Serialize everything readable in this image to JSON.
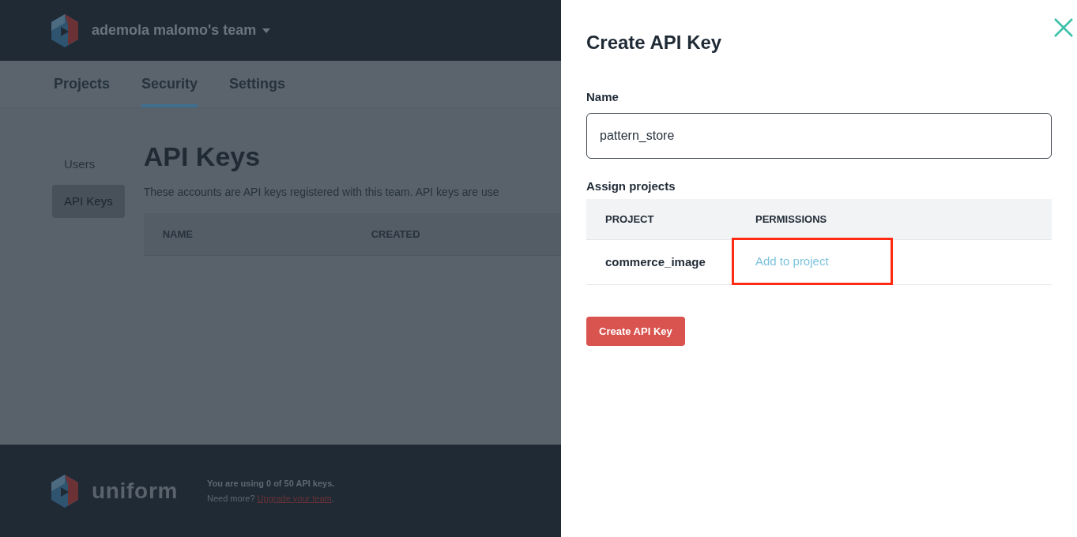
{
  "header": {
    "team": "ademola malomo's team"
  },
  "tabs": [
    {
      "label": "Projects",
      "selected": false
    },
    {
      "label": "Security",
      "selected": true
    },
    {
      "label": "Settings",
      "selected": false
    }
  ],
  "sidebar": {
    "items": [
      {
        "label": "Users",
        "selected": false
      },
      {
        "label": "API Keys",
        "selected": true
      }
    ]
  },
  "page": {
    "title": "API Keys",
    "description": "These accounts are API keys registered with this team. API keys are use",
    "columns": [
      "NAME",
      "CREATED"
    ]
  },
  "footer": {
    "brand": "uniform",
    "usage": "You are using 0 of 50 API keys.",
    "prompt": "Need more?",
    "link": "Upgrade your team",
    "after_link": "."
  },
  "drawer": {
    "title": "Create API Key",
    "name_label": "Name",
    "name_value": "pattern_store",
    "assign_label": "Assign projects",
    "columns": [
      "PROJECT",
      "PERMISSIONS"
    ],
    "rows": [
      {
        "project": "commerce_image",
        "action": "Add to project",
        "highlighted": true
      }
    ],
    "submit": "Create API Key"
  }
}
